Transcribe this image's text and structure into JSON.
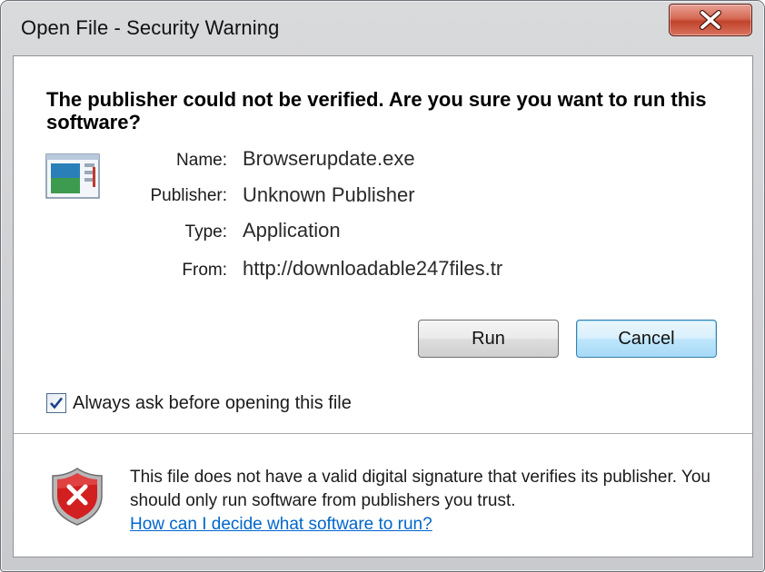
{
  "window": {
    "title": "Open File - Security Warning",
    "close_symbol": "x"
  },
  "heading": "The publisher could not be verified.  Are you sure you want to run this software?",
  "icons": {
    "file": "application-file-icon",
    "close": "close-icon",
    "checkmark": "checkmark-icon",
    "shield": "security-shield-error-icon"
  },
  "fields": {
    "name": {
      "label": "Name:",
      "value": "Browserupdate.exe"
    },
    "publisher": {
      "label": "Publisher:",
      "value": "Unknown Publisher"
    },
    "type": {
      "label": "Type:",
      "value": "Application"
    },
    "from": {
      "label": "From:",
      "value": "http://downloadable247files.tr"
    }
  },
  "buttons": {
    "run": "Run",
    "cancel": "Cancel"
  },
  "checkbox": {
    "label": "Always ask before opening this file",
    "checked": true
  },
  "warning": {
    "text": "This file does not have a valid digital signature that verifies its publisher.  You should only run software from publishers you trust.",
    "link": "How can I decide what software to run?"
  },
  "colors": {
    "link": "#0066cc",
    "close_button": "#c2432c",
    "shield_red": "#d21f1f",
    "default_button_border": "#3c7fb1"
  }
}
